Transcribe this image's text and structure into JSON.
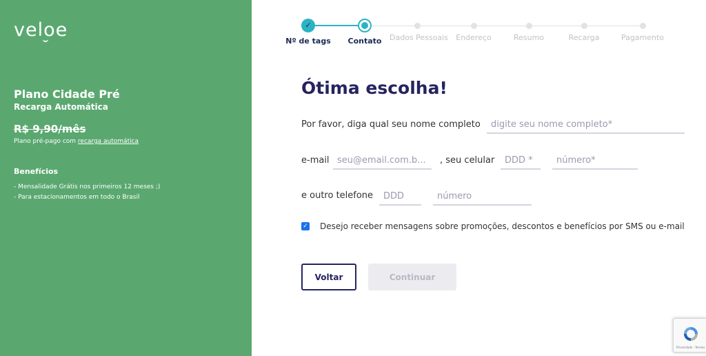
{
  "sidebar": {
    "logo": "veloe",
    "plan_name": "Plano Cidade Pré",
    "plan_subtitle": "Recarga Automática",
    "plan_price": "R$ 9,90/mês",
    "plan_desc_prefix": "Plano pré-pago com ",
    "plan_desc_link": "recarga automática",
    "benefits_title": "Benefícios",
    "benefits": [
      "- Mensalidade Grátis nos primeiros 12 meses ;)",
      "- Para estacionamentos em todo o Brasil"
    ]
  },
  "steps": [
    {
      "label": "Nº de tags",
      "status": "done"
    },
    {
      "label": "Contato",
      "status": "current"
    },
    {
      "label": "Dados Pessoais",
      "status": "pending"
    },
    {
      "label": "Endereço",
      "status": "pending"
    },
    {
      "label": "Resumo",
      "status": "pending"
    },
    {
      "label": "Recarga",
      "status": "pending"
    },
    {
      "label": "Pagamento",
      "status": "pending"
    }
  ],
  "form": {
    "heading": "Ótima escolha!",
    "name_label": "Por favor, diga qual seu nome completo",
    "name_placeholder": "digite seu nome completo*",
    "email_label": "e-mail",
    "email_placeholder": "seu@email.com.b...",
    "phone_label": ", seu celular",
    "ddd_placeholder": "DDD *",
    "number_placeholder": "número*",
    "other_phone_label": "e outro telefone",
    "other_ddd_placeholder": "DDD",
    "other_number_placeholder": "número",
    "checkbox_checked": true,
    "checkbox_label": "Desejo receber mensagens sobre promoções, descontos e benefícios por SMS ou e-mail"
  },
  "buttons": {
    "back": "Voltar",
    "continue": "Continuar"
  },
  "recaptcha": {
    "text": "Privacidade - Termos"
  },
  "colors": {
    "sidebar": "#5aa870",
    "accent": "#2bb3c4",
    "heading": "#25245f"
  }
}
